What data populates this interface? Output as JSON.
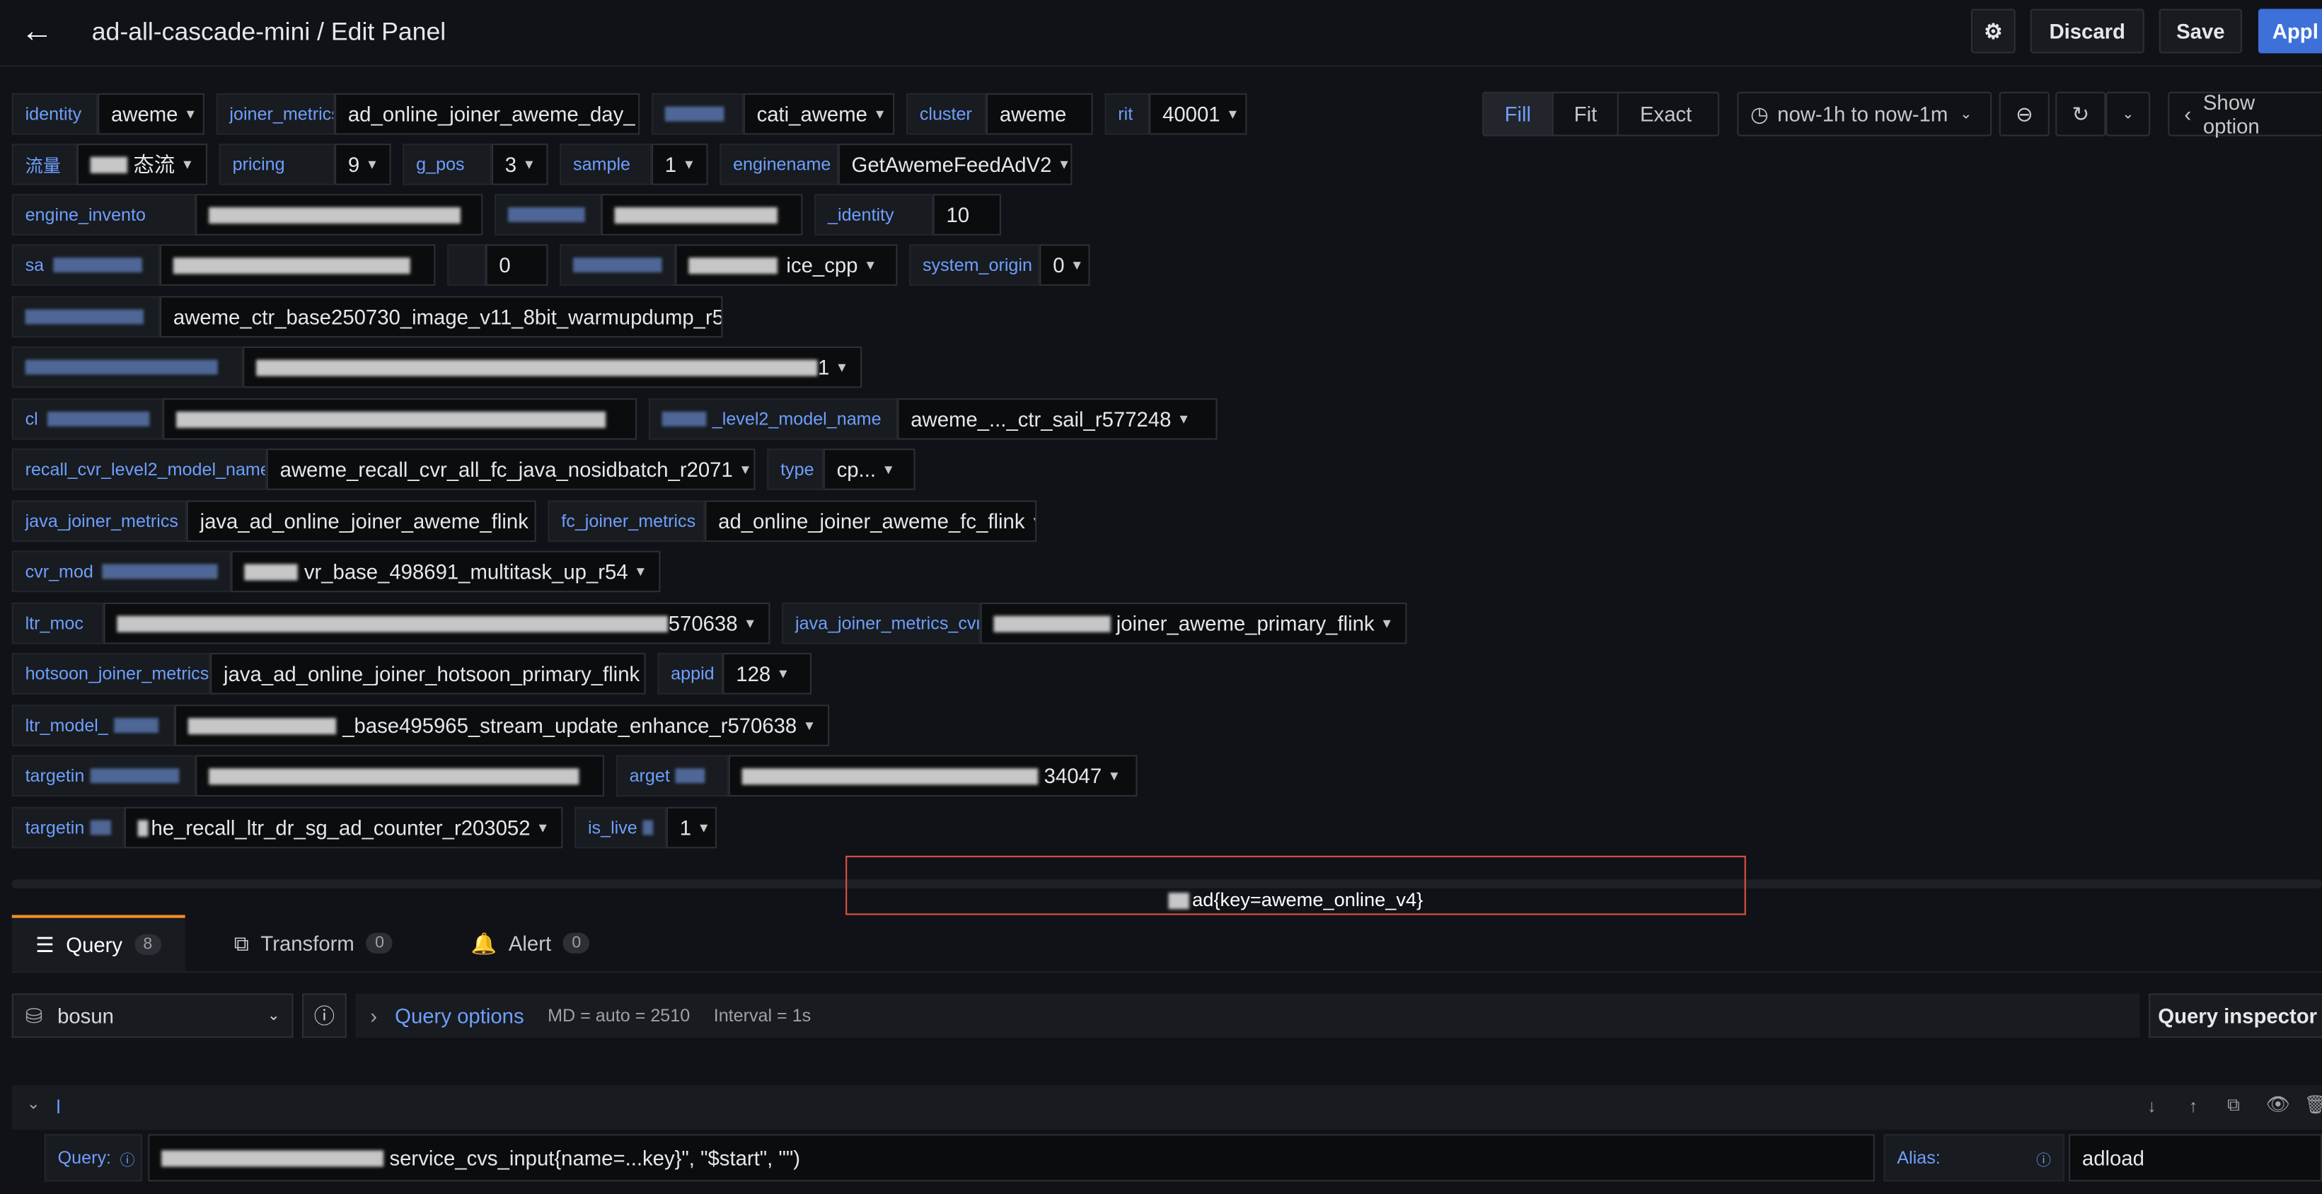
{
  "header": {
    "title": "ad-all-cascade-mini / Edit Panel",
    "discard_label": "Discard",
    "save_label": "Save",
    "apply_label": "Appl"
  },
  "view_modes": [
    "Fill",
    "Fit",
    "Exact"
  ],
  "active_view_mode": "Fill",
  "time_range": "now-1h to now-1m",
  "show_options": "Show option",
  "variables": [
    {
      "label": "identity",
      "value": "aweme"
    },
    {
      "label": "joiner_metrics",
      "value": "ad_online_joiner_aweme_day_"
    },
    {
      "label": "",
      "value": "cati_aweme"
    },
    {
      "label": "cluster",
      "value": "aweme"
    },
    {
      "label": "rit",
      "value": "40001"
    },
    {
      "label": "流量",
      "value": "态流"
    },
    {
      "label": "pricing",
      "value": "9"
    },
    {
      "label": "g_pos",
      "value": "3"
    },
    {
      "label": "sample",
      "value": "1"
    },
    {
      "label": "enginename",
      "value": "GetAwemeFeedAdV2"
    },
    {
      "label": "engine_invento",
      "value": ""
    },
    {
      "label": "",
      "value": ""
    },
    {
      "label": "_identity",
      "value": "10"
    },
    {
      "label": "sa",
      "value": ""
    },
    {
      "label": "",
      "value": "0"
    },
    {
      "label": "",
      "value": "ice_cpp"
    },
    {
      "label": "system_origin",
      "value": "0"
    },
    {
      "label": "",
      "value": "aweme_ctr_base250730_image_v11_8bit_warmupdump_r5"
    },
    {
      "label": "",
      "value": "1"
    },
    {
      "label": "cl",
      "value": ""
    },
    {
      "label": "_level2_model_name",
      "value": "aweme_..._ctr_sail_r577248"
    },
    {
      "label": "recall_cvr_level2_model_name",
      "value": "aweme_recall_cvr_all_fc_java_nosidbatch_r2071"
    },
    {
      "label": "type",
      "value": "cp..."
    },
    {
      "label": "java_joiner_metrics",
      "value": "java_ad_online_joiner_aweme_flink"
    },
    {
      "label": "fc_joiner_metrics",
      "value": "ad_online_joiner_aweme_fc_flink"
    },
    {
      "label": "cvr_mod",
      "value": "vr_base_498691_multitask_up_r54"
    },
    {
      "label": "ltr_moc",
      "value": "570638"
    },
    {
      "label": "java_joiner_metrics_cvr",
      "value": "joiner_aweme_primary_flink"
    },
    {
      "label": "hotsoon_joiner_metrics",
      "value": "java_ad_online_joiner_hotsoon_primary_flink"
    },
    {
      "label": "appid",
      "value": "128"
    },
    {
      "label": "ltr_model_",
      "value": "_base495965_stream_update_enhance_r570638"
    },
    {
      "label": "targetin",
      "value": ""
    },
    {
      "label": "arget",
      "value": "34047"
    },
    {
      "label": "targetin",
      "value": "he_recall_ltr_dr_sg_ad_counter_r203052"
    },
    {
      "label": "is_live",
      "value": "1"
    }
  ],
  "panel_preview_text": "ad{key=aweme_online_v4}",
  "tabs": [
    {
      "label": "Query",
      "count": "8"
    },
    {
      "label": "Transform",
      "count": "0"
    },
    {
      "label": "Alert",
      "count": "0"
    }
  ],
  "datasource": "bosun",
  "query_options": {
    "label": "Query options",
    "md": "MD = auto = 2510",
    "interval": "Interval = 1s"
  },
  "query_inspector": "Query inspector",
  "query_row": {
    "ref": "l",
    "query_label": "Query:",
    "query_value": "service_cvs_input{name=...key}\", \"$start\", \"\")",
    "alias_label": "Alias:",
    "alias_value": "adload"
  },
  "colors": {
    "accent": "#6e9fff",
    "apply": "#3d71d9",
    "tab_active": "#f08e27",
    "highlight": "#e0533f"
  }
}
